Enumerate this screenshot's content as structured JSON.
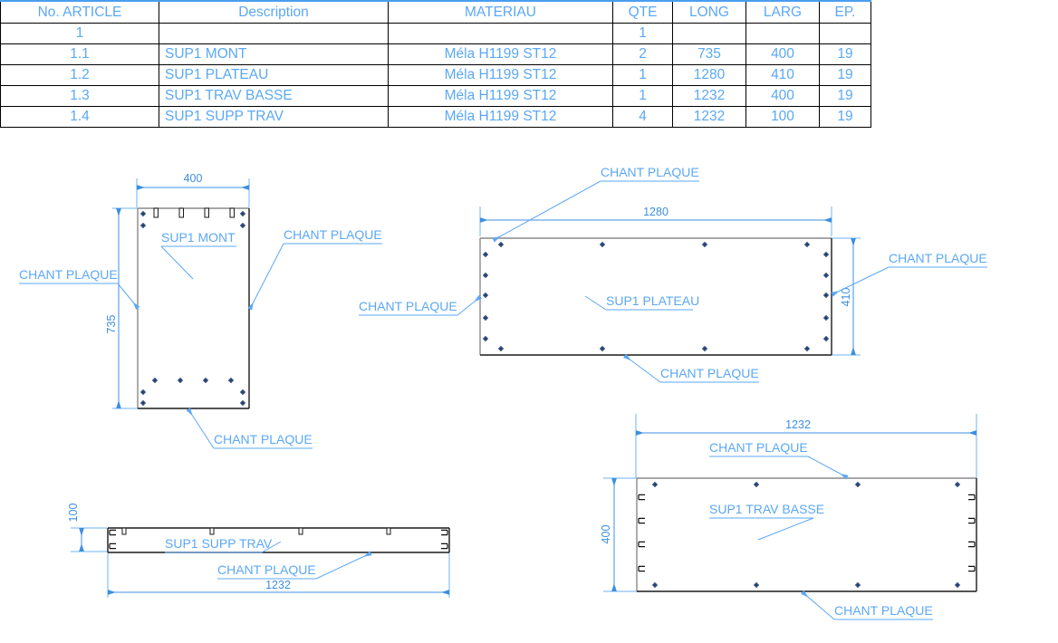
{
  "table": {
    "headers": [
      "No. ARTICLE",
      "Description",
      "MATERIAU",
      "QTE",
      "LONG",
      "LARG",
      "EP."
    ],
    "rows": [
      {
        "no": "1",
        "description": "",
        "materiau": "",
        "qte": "1",
        "long": "",
        "larg": "",
        "ep": ""
      },
      {
        "no": "1.1",
        "description": "SUP1 MONT",
        "materiau": "Méla H1199 ST12",
        "qte": "2",
        "long": "735",
        "larg": "400",
        "ep": "19"
      },
      {
        "no": "1.2",
        "description": "SUP1 PLATEAU",
        "materiau": "Méla H1199 ST12",
        "qte": "1",
        "long": "1280",
        "larg": "410",
        "ep": "19"
      },
      {
        "no": "1.3",
        "description": "SUP1 TRAV BASSE",
        "materiau": "Méla H1199 ST12",
        "qte": "1",
        "long": "1232",
        "larg": "400",
        "ep": "19"
      },
      {
        "no": "1.4",
        "description": "SUP1 SUPP TRAV",
        "materiau": "Méla H1199 ST12",
        "qte": "4",
        "long": "1232",
        "larg": "100",
        "ep": "19"
      }
    ]
  },
  "views": {
    "mont": {
      "part_label": "SUP1 MONT",
      "dim_width": "400",
      "dim_height": "735",
      "edge_label_top_left": "CHANT PLAQUE",
      "edge_label_left": "CHANT PLAQUE",
      "edge_label_right": "CHANT PLAQUE",
      "edge_label_bottom": "CHANT PLAQUE"
    },
    "plateau": {
      "part_label": "SUP1 PLATEAU",
      "dim_width": "1280",
      "dim_height": "410",
      "edge_label_top": "CHANT PLAQUE",
      "edge_label_left": "CHANT PLAQUE",
      "edge_label_right": "CHANT PLAQUE",
      "edge_label_bottom": "CHANT PLAQUE"
    },
    "supp_trav": {
      "part_label": "SUP1 SUPP TRAV",
      "dim_length": "1232",
      "dim_height": "100",
      "edge_label_bottom": "CHANT PLAQUE"
    },
    "trav_basse": {
      "part_label": "SUP1 TRAV BASSE",
      "dim_length": "1232",
      "dim_height": "400",
      "edge_label_top": "CHANT PLAQUE",
      "edge_label_bottom": "CHANT PLAQUE"
    }
  },
  "colors": {
    "text_blue": "#5ba8f5",
    "dim_blue": "#3d8fe0",
    "edge_dark": "#1a1a1a",
    "edge_gray": "#8a8a8a",
    "marker_navy": "#1f3d6e"
  }
}
